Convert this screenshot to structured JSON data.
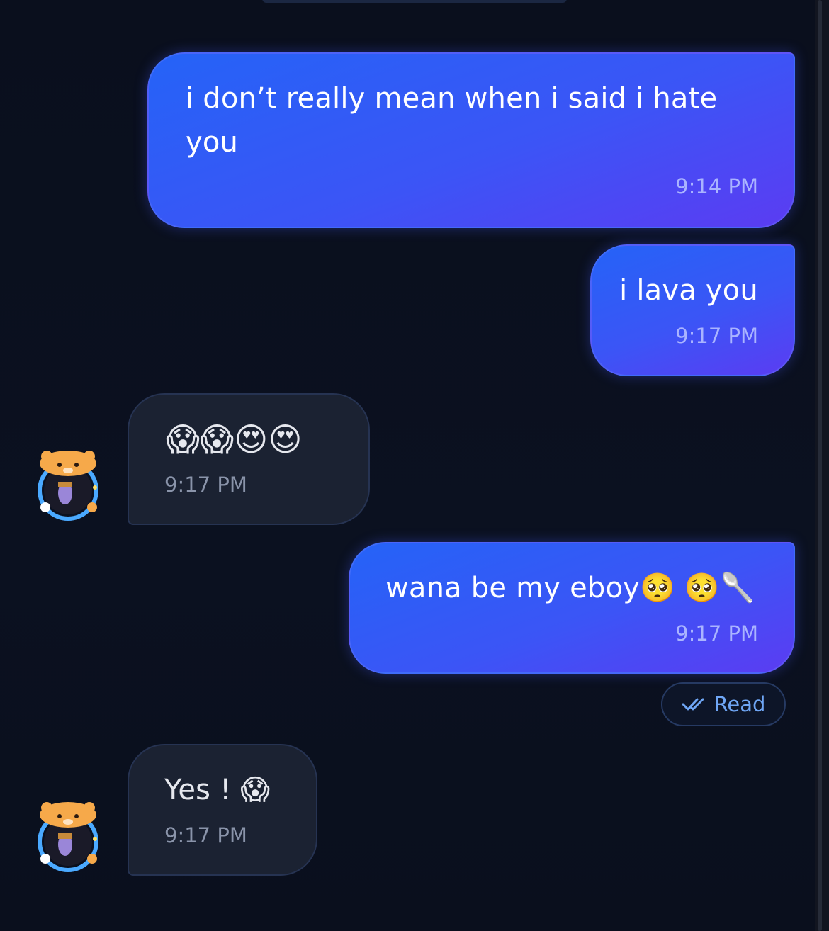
{
  "messages": [
    {
      "direction": "outgoing",
      "text": "i don’t really mean when i said i hate you",
      "time": "9:14 PM"
    },
    {
      "direction": "outgoing",
      "text": "i lava you",
      "time": "9:17 PM"
    },
    {
      "direction": "incoming",
      "text": "😱😱😍😍",
      "time": "9:17 PM",
      "sender_avatar": "avatar-icon"
    },
    {
      "direction": "outgoing",
      "text": "wana be my eboy🥺 🥺🥄",
      "time": "9:17 PM"
    },
    {
      "direction": "incoming",
      "text": "Yes ! 😱",
      "time": "9:17 PM",
      "sender_avatar": "avatar-icon"
    }
  ],
  "receipt": {
    "label": "Read",
    "icon": "double-check-icon"
  },
  "colors": {
    "background": "#0a0f1d",
    "outgoing_start": "#2563f7",
    "outgoing_end": "#5b3cf2",
    "incoming_bg": "#1b2232",
    "read_accent": "#6fa6f5"
  }
}
